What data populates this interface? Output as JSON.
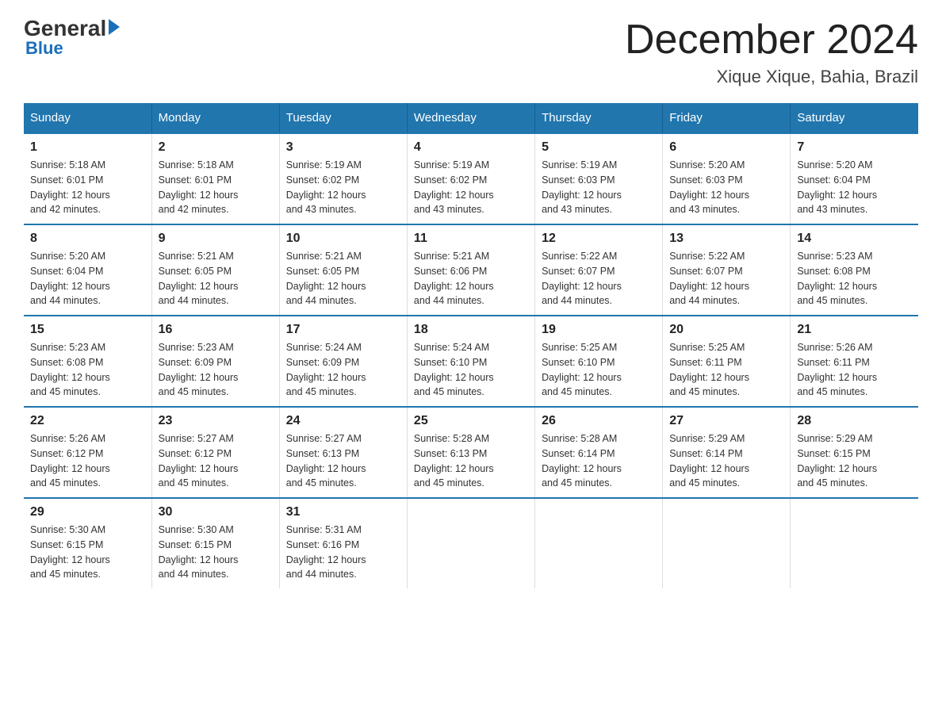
{
  "header": {
    "logo": {
      "general": "General",
      "blue": "Blue"
    },
    "title": "December 2024",
    "location": "Xique Xique, Bahia, Brazil"
  },
  "calendar": {
    "days_of_week": [
      "Sunday",
      "Monday",
      "Tuesday",
      "Wednesday",
      "Thursday",
      "Friday",
      "Saturday"
    ],
    "weeks": [
      [
        {
          "day": "1",
          "sunrise": "5:18 AM",
          "sunset": "6:01 PM",
          "daylight": "12 hours and 42 minutes."
        },
        {
          "day": "2",
          "sunrise": "5:18 AM",
          "sunset": "6:01 PM",
          "daylight": "12 hours and 42 minutes."
        },
        {
          "day": "3",
          "sunrise": "5:19 AM",
          "sunset": "6:02 PM",
          "daylight": "12 hours and 43 minutes."
        },
        {
          "day": "4",
          "sunrise": "5:19 AM",
          "sunset": "6:02 PM",
          "daylight": "12 hours and 43 minutes."
        },
        {
          "day": "5",
          "sunrise": "5:19 AM",
          "sunset": "6:03 PM",
          "daylight": "12 hours and 43 minutes."
        },
        {
          "day": "6",
          "sunrise": "5:20 AM",
          "sunset": "6:03 PM",
          "daylight": "12 hours and 43 minutes."
        },
        {
          "day": "7",
          "sunrise": "5:20 AM",
          "sunset": "6:04 PM",
          "daylight": "12 hours and 43 minutes."
        }
      ],
      [
        {
          "day": "8",
          "sunrise": "5:20 AM",
          "sunset": "6:04 PM",
          "daylight": "12 hours and 44 minutes."
        },
        {
          "day": "9",
          "sunrise": "5:21 AM",
          "sunset": "6:05 PM",
          "daylight": "12 hours and 44 minutes."
        },
        {
          "day": "10",
          "sunrise": "5:21 AM",
          "sunset": "6:05 PM",
          "daylight": "12 hours and 44 minutes."
        },
        {
          "day": "11",
          "sunrise": "5:21 AM",
          "sunset": "6:06 PM",
          "daylight": "12 hours and 44 minutes."
        },
        {
          "day": "12",
          "sunrise": "5:22 AM",
          "sunset": "6:07 PM",
          "daylight": "12 hours and 44 minutes."
        },
        {
          "day": "13",
          "sunrise": "5:22 AM",
          "sunset": "6:07 PM",
          "daylight": "12 hours and 44 minutes."
        },
        {
          "day": "14",
          "sunrise": "5:23 AM",
          "sunset": "6:08 PM",
          "daylight": "12 hours and 45 minutes."
        }
      ],
      [
        {
          "day": "15",
          "sunrise": "5:23 AM",
          "sunset": "6:08 PM",
          "daylight": "12 hours and 45 minutes."
        },
        {
          "day": "16",
          "sunrise": "5:23 AM",
          "sunset": "6:09 PM",
          "daylight": "12 hours and 45 minutes."
        },
        {
          "day": "17",
          "sunrise": "5:24 AM",
          "sunset": "6:09 PM",
          "daylight": "12 hours and 45 minutes."
        },
        {
          "day": "18",
          "sunrise": "5:24 AM",
          "sunset": "6:10 PM",
          "daylight": "12 hours and 45 minutes."
        },
        {
          "day": "19",
          "sunrise": "5:25 AM",
          "sunset": "6:10 PM",
          "daylight": "12 hours and 45 minutes."
        },
        {
          "day": "20",
          "sunrise": "5:25 AM",
          "sunset": "6:11 PM",
          "daylight": "12 hours and 45 minutes."
        },
        {
          "day": "21",
          "sunrise": "5:26 AM",
          "sunset": "6:11 PM",
          "daylight": "12 hours and 45 minutes."
        }
      ],
      [
        {
          "day": "22",
          "sunrise": "5:26 AM",
          "sunset": "6:12 PM",
          "daylight": "12 hours and 45 minutes."
        },
        {
          "day": "23",
          "sunrise": "5:27 AM",
          "sunset": "6:12 PM",
          "daylight": "12 hours and 45 minutes."
        },
        {
          "day": "24",
          "sunrise": "5:27 AM",
          "sunset": "6:13 PM",
          "daylight": "12 hours and 45 minutes."
        },
        {
          "day": "25",
          "sunrise": "5:28 AM",
          "sunset": "6:13 PM",
          "daylight": "12 hours and 45 minutes."
        },
        {
          "day": "26",
          "sunrise": "5:28 AM",
          "sunset": "6:14 PM",
          "daylight": "12 hours and 45 minutes."
        },
        {
          "day": "27",
          "sunrise": "5:29 AM",
          "sunset": "6:14 PM",
          "daylight": "12 hours and 45 minutes."
        },
        {
          "day": "28",
          "sunrise": "5:29 AM",
          "sunset": "6:15 PM",
          "daylight": "12 hours and 45 minutes."
        }
      ],
      [
        {
          "day": "29",
          "sunrise": "5:30 AM",
          "sunset": "6:15 PM",
          "daylight": "12 hours and 45 minutes."
        },
        {
          "day": "30",
          "sunrise": "5:30 AM",
          "sunset": "6:15 PM",
          "daylight": "12 hours and 44 minutes."
        },
        {
          "day": "31",
          "sunrise": "5:31 AM",
          "sunset": "6:16 PM",
          "daylight": "12 hours and 44 minutes."
        },
        null,
        null,
        null,
        null
      ]
    ],
    "labels": {
      "sunrise": "Sunrise:",
      "sunset": "Sunset:",
      "daylight": "Daylight: 12 hours"
    }
  }
}
